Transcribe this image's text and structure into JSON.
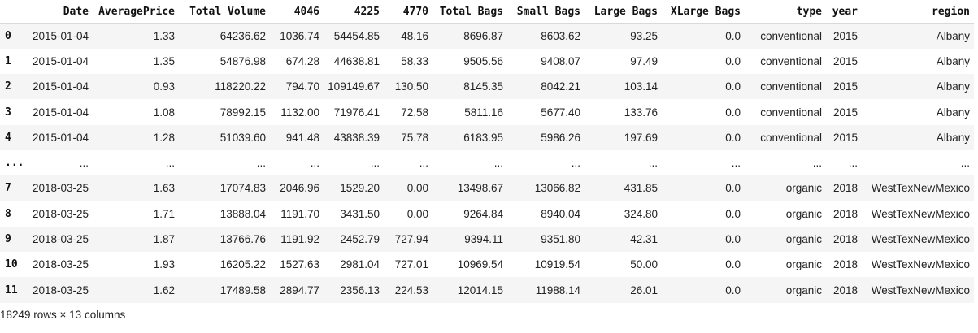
{
  "table": {
    "columns": [
      "",
      "Date",
      "AveragePrice",
      "Total Volume",
      "4046",
      "4225",
      "4770",
      "Total Bags",
      "Small Bags",
      "Large Bags",
      "XLarge Bags",
      "type",
      "year",
      "region"
    ],
    "rows": [
      {
        "index": "0",
        "cells": [
          "2015-01-04",
          "1.33",
          "64236.62",
          "1036.74",
          "54454.85",
          "48.16",
          "8696.87",
          "8603.62",
          "93.25",
          "0.0",
          "conventional",
          "2015",
          "Albany"
        ]
      },
      {
        "index": "1",
        "cells": [
          "2015-01-04",
          "1.35",
          "54876.98",
          "674.28",
          "44638.81",
          "58.33",
          "9505.56",
          "9408.07",
          "97.49",
          "0.0",
          "conventional",
          "2015",
          "Albany"
        ]
      },
      {
        "index": "2",
        "cells": [
          "2015-01-04",
          "0.93",
          "118220.22",
          "794.70",
          "109149.67",
          "130.50",
          "8145.35",
          "8042.21",
          "103.14",
          "0.0",
          "conventional",
          "2015",
          "Albany"
        ]
      },
      {
        "index": "3",
        "cells": [
          "2015-01-04",
          "1.08",
          "78992.15",
          "1132.00",
          "71976.41",
          "72.58",
          "5811.16",
          "5677.40",
          "133.76",
          "0.0",
          "conventional",
          "2015",
          "Albany"
        ]
      },
      {
        "index": "4",
        "cells": [
          "2015-01-04",
          "1.28",
          "51039.60",
          "941.48",
          "43838.39",
          "75.78",
          "6183.95",
          "5986.26",
          "197.69",
          "0.0",
          "conventional",
          "2015",
          "Albany"
        ]
      },
      {
        "index": "...",
        "cells": [
          "...",
          "...",
          "...",
          "...",
          "...",
          "...",
          "...",
          "...",
          "...",
          "...",
          "...",
          "...",
          "..."
        ]
      },
      {
        "index": "7",
        "cells": [
          "2018-03-25",
          "1.63",
          "17074.83",
          "2046.96",
          "1529.20",
          "0.00",
          "13498.67",
          "13066.82",
          "431.85",
          "0.0",
          "organic",
          "2018",
          "WestTexNewMexico"
        ]
      },
      {
        "index": "8",
        "cells": [
          "2018-03-25",
          "1.71",
          "13888.04",
          "1191.70",
          "3431.50",
          "0.00",
          "9264.84",
          "8940.04",
          "324.80",
          "0.0",
          "organic",
          "2018",
          "WestTexNewMexico"
        ]
      },
      {
        "index": "9",
        "cells": [
          "2018-03-25",
          "1.87",
          "13766.76",
          "1191.92",
          "2452.79",
          "727.94",
          "9394.11",
          "9351.80",
          "42.31",
          "0.0",
          "organic",
          "2018",
          "WestTexNewMexico"
        ]
      },
      {
        "index": "10",
        "cells": [
          "2018-03-25",
          "1.93",
          "16205.22",
          "1527.63",
          "2981.04",
          "727.01",
          "10969.54",
          "10919.54",
          "50.00",
          "0.0",
          "organic",
          "2018",
          "WestTexNewMexico"
        ]
      },
      {
        "index": "11",
        "cells": [
          "2018-03-25",
          "1.62",
          "17489.58",
          "2894.77",
          "2356.13",
          "224.53",
          "12014.15",
          "11988.14",
          "26.01",
          "0.0",
          "organic",
          "2018",
          "WestTexNewMexico"
        ]
      }
    ]
  },
  "footer": {
    "shape_text": "18249 rows × 13 columns"
  }
}
